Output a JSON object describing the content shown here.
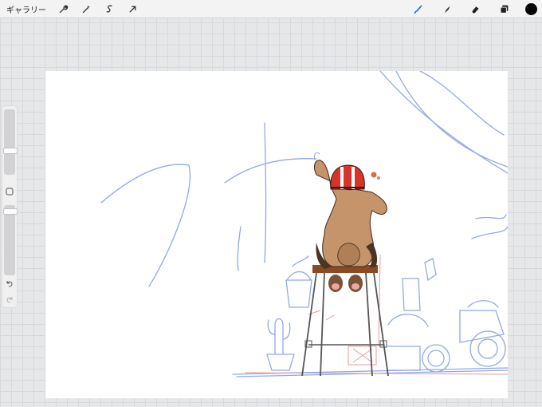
{
  "toolbar": {
    "gallery_label": "ギャラリー",
    "left_tools": [
      "wrench-icon",
      "magic-wand-icon",
      "selection-s-icon",
      "transform-arrow-icon"
    ],
    "right_tools": [
      "brush-icon",
      "smudge-icon",
      "eraser-icon",
      "layers-icon"
    ],
    "active_color": "#050505",
    "accent": "#1e6fd9"
  },
  "sidebar": {
    "brush_size_level": 0.62,
    "opacity_level": 0.08,
    "buttons": [
      "modify-square",
      "undo",
      "redo"
    ]
  },
  "canvas": {
    "background": "#ffffff",
    "sketch_color": "#93a9e4",
    "helmet_color": "#d9332b",
    "fur_color": "#c6946a"
  }
}
